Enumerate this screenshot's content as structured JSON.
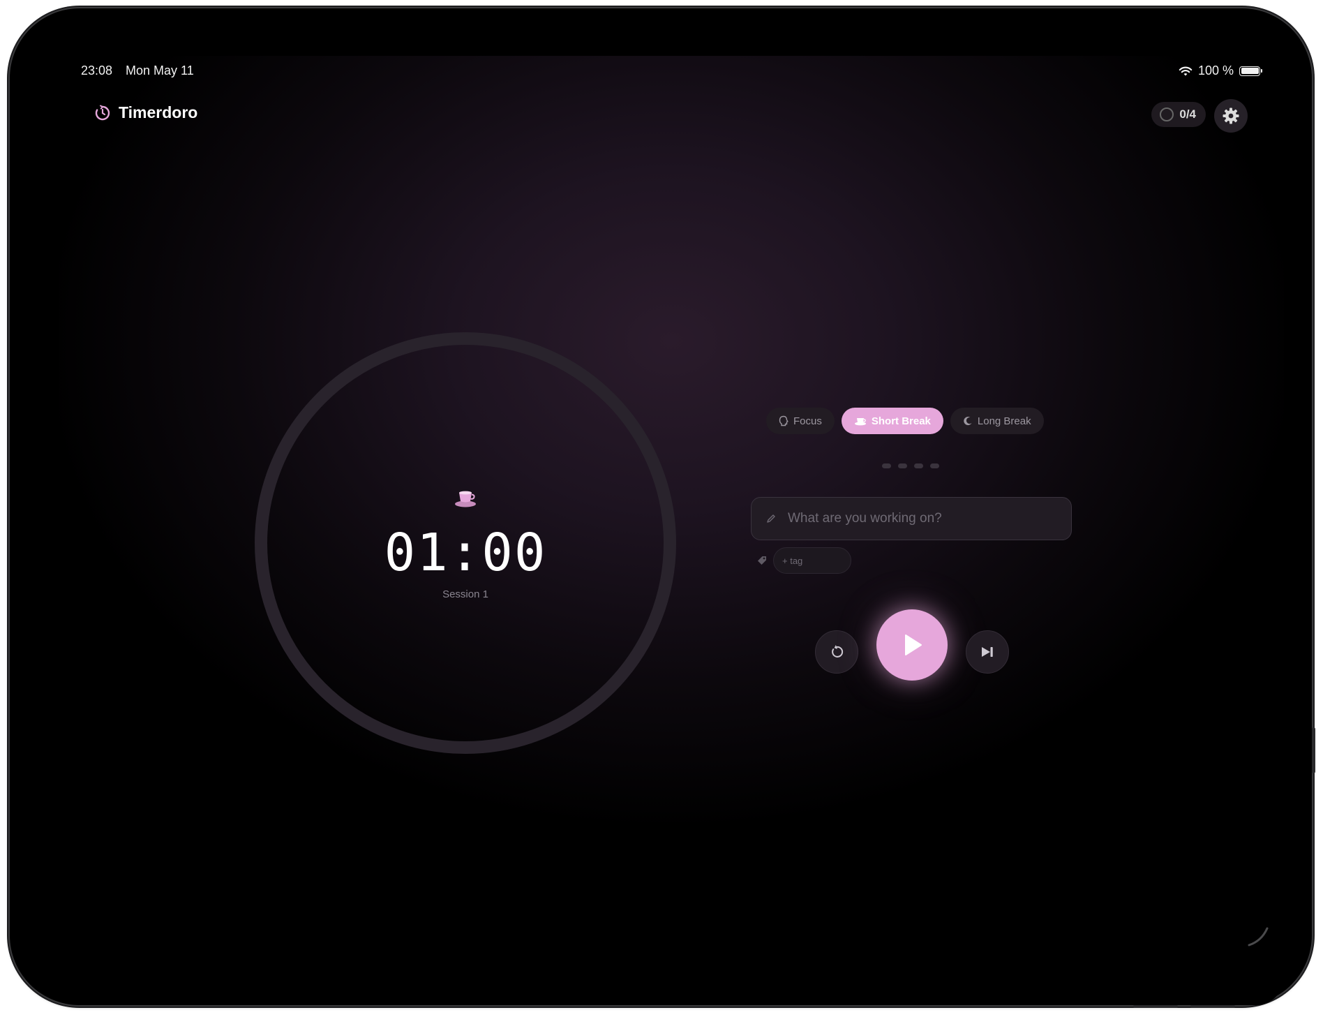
{
  "status_bar": {
    "time": "23:08",
    "date": "Mon May 11",
    "battery": "100 %"
  },
  "header": {
    "app_title": "Timerdoro",
    "session_count": "0/4"
  },
  "timer": {
    "value": "01:00",
    "session_label": "Session 1",
    "icon": "coffee-cup-icon"
  },
  "modes": {
    "items": [
      {
        "label": "Focus",
        "icon": "brain-icon",
        "active": false
      },
      {
        "label": "Short Break",
        "icon": "coffee-cup-icon",
        "active": true
      },
      {
        "label": "Long Break",
        "icon": "moon-icon",
        "active": false
      }
    ]
  },
  "session_dots": 4,
  "task": {
    "placeholder": "What are you working on?",
    "tag_placeholder": "+ tag"
  },
  "colors": {
    "accent": "#e6a7db",
    "surface": "#221c24",
    "background": "#000000"
  }
}
